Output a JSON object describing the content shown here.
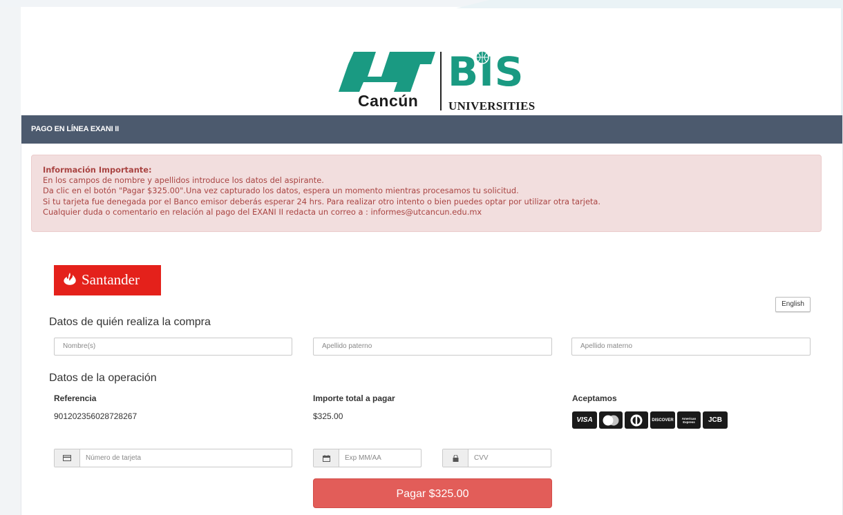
{
  "logo": {
    "city": "Cancún",
    "brand": "BIS",
    "subtitle": "UNIVERSITIES"
  },
  "panel": {
    "title": "PAGO EN LÍNEA EXANI II"
  },
  "alert": {
    "title": "Información Importante:",
    "lines": [
      "En los campos de nombre y apellidos introduce los datos del aspirante.",
      "Da clic en el botón \"Pagar $325.00\".Una vez capturado los datos, espera un momento mientras procesamos tu solicitud.",
      "Si tu tarjeta fue denegada por el Banco emisor deberás esperar 24 hrs. Para realizar otro intento o bien puedes optar por utilizar otra tarjeta.",
      "Cualquier duda o comentario en relación al pago del EXANI II redacta un correo a : informes@utcancun.edu.mx"
    ]
  },
  "bank": {
    "name": "Santander"
  },
  "language_button": "English",
  "buyer": {
    "section_title": "Datos de quién realiza la compra",
    "name_placeholder": "Nombre(s)",
    "paternal_placeholder": "Apellido paterno",
    "maternal_placeholder": "Apellido materno"
  },
  "operation": {
    "section_title": "Datos de la operación",
    "reference_label": "Referencia",
    "reference_value": "901202356028728267",
    "amount_label": "Importe total a pagar",
    "amount_value": "$325.00",
    "accepted_label": "Aceptamos",
    "accepted_cards": [
      "VISA",
      "MasterCard",
      "Diners Club",
      "DISCOVER",
      "American Express",
      "JCB"
    ]
  },
  "payment": {
    "card_number_placeholder": "Número de tarjeta",
    "expiry_placeholder": "Exp MM/AA",
    "cvv_placeholder": "CVV",
    "pay_button": "Pagar $325.00"
  },
  "colors": {
    "header_bg": "#4c5a6e",
    "alert_bg": "#f2dede",
    "alert_text": "#a94442",
    "santander_red": "#e4211b",
    "pay_button": "#e25d59",
    "logo_green": "#1a9a82"
  }
}
